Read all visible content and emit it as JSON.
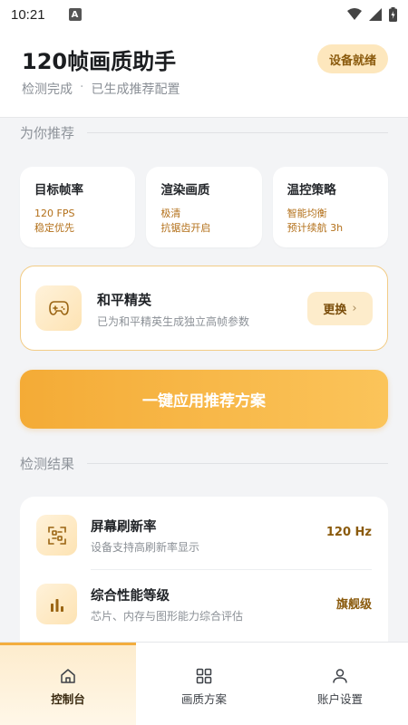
{
  "status_bar": {
    "time": "10:21",
    "notification_letter": "A"
  },
  "header": {
    "title": "120帧画质助手",
    "subtitle_left": "检测完成",
    "subtitle_sep": "·",
    "subtitle_right": "已生成推荐配置",
    "badge": "设备就绪"
  },
  "recommend": {
    "section_title": "为你推荐",
    "cards": [
      {
        "title": "目标帧率",
        "line1": "120 FPS",
        "line2": "稳定优先"
      },
      {
        "title": "渲染画质",
        "line1": "极清",
        "line2": "抗锯齿开启"
      },
      {
        "title": "温控策略",
        "line1": "智能均衡",
        "line2": "预计续航 3h"
      }
    ]
  },
  "game": {
    "name": "和平精英",
    "desc": "已为和平精英生成独立高帧参数",
    "change_label": "更换",
    "change_chevron": "›"
  },
  "apply_button": "一键应用推荐方案",
  "results": {
    "section_title": "检测结果",
    "items": [
      {
        "title": "屏幕刷新率",
        "desc": "设备支持高刷新率显示",
        "value": "120 Hz",
        "icon": "scan-icon"
      },
      {
        "title": "综合性能等级",
        "desc": "芯片、内存与图形能力综合评估",
        "value": "旗舰级",
        "icon": "bar-chart-icon"
      }
    ]
  },
  "nav": {
    "items": [
      {
        "label": "控制台",
        "icon": "home-icon"
      },
      {
        "label": "画质方案",
        "icon": "grid-icon"
      },
      {
        "label": "账户设置",
        "icon": "user-icon"
      }
    ]
  },
  "colors": {
    "accent": "#f4ab36",
    "accent_text": "#8a5a0c",
    "highlight_text": "#b3701a"
  }
}
